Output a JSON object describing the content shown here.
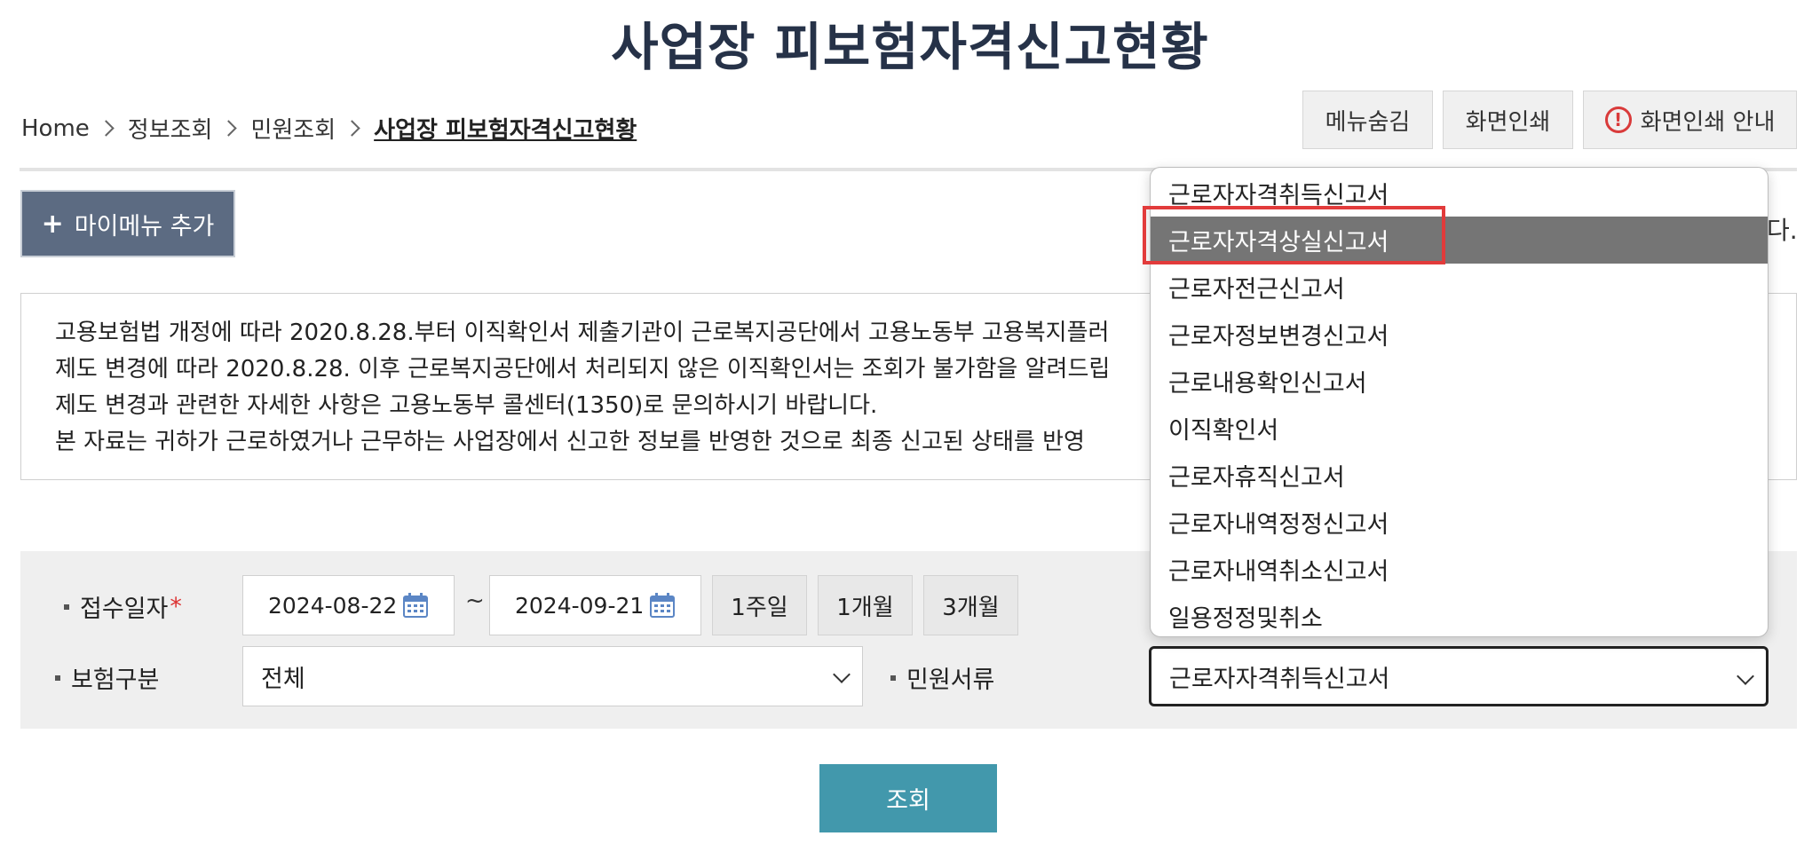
{
  "page": {
    "title": "사업장 피보험자격신고현황"
  },
  "breadcrumb": {
    "items": [
      "Home",
      "정보조회",
      "민원조회"
    ],
    "current": "사업장 피보험자격신고현황"
  },
  "top_buttons": {
    "hide_menu": "메뉴숨김",
    "print": "화면인쇄",
    "print_guide": "화면인쇄 안내"
  },
  "mymenu": {
    "label": "마이메뉴 추가"
  },
  "stray": {
    "char": "다."
  },
  "notice": {
    "lines": [
      "고용보험법 개정에 따라 2020.8.28.부터 이직확인서 제출기관이 근로복지공단에서 고용노동부 고용복지플러",
      "제도 변경에 따라 2020.8.28. 이후 근로복지공단에서 처리되지 않은 이직확인서는 조회가 불가함을 알려드립",
      "제도 변경과 관련한 자세한 사항은 고용노동부 콜센터(1350)로 문의하시기 바랍니다.",
      "본 자료는 귀하가 근로하였거나 근무하는 사업장에서 신고한 정보를 반영한 것으로 최종 신고된 상태를 반영"
    ]
  },
  "search": {
    "date_label": "접수일자",
    "required_mark": "*",
    "start_date": "2024-08-22",
    "tilde": "~",
    "end_date": "2024-09-21",
    "periods": [
      "1주일",
      "1개월",
      "3개월"
    ],
    "insurance_label": "보험구분",
    "insurance_value": "전체",
    "doc_label": "민원서류",
    "doc_value": "근로자자격취득신고서",
    "submit": "조회"
  },
  "dropdown": {
    "options": [
      "근로자자격취득신고서",
      "근로자자격상실신고서",
      "근로자전근신고서",
      "근로자정보변경신고서",
      "근로내용확인신고서",
      "이직확인서",
      "근로자휴직신고서",
      "근로자내역정정신고서",
      "근로자내역취소신고서",
      "일용정정및취소"
    ],
    "highlighted_index": 1
  },
  "colors": {
    "title": "#263248",
    "mymenu_bg": "#5c6b82",
    "search_btn": "#4298ac",
    "highlight": "#e23b3b",
    "selected_option": "#757575"
  }
}
